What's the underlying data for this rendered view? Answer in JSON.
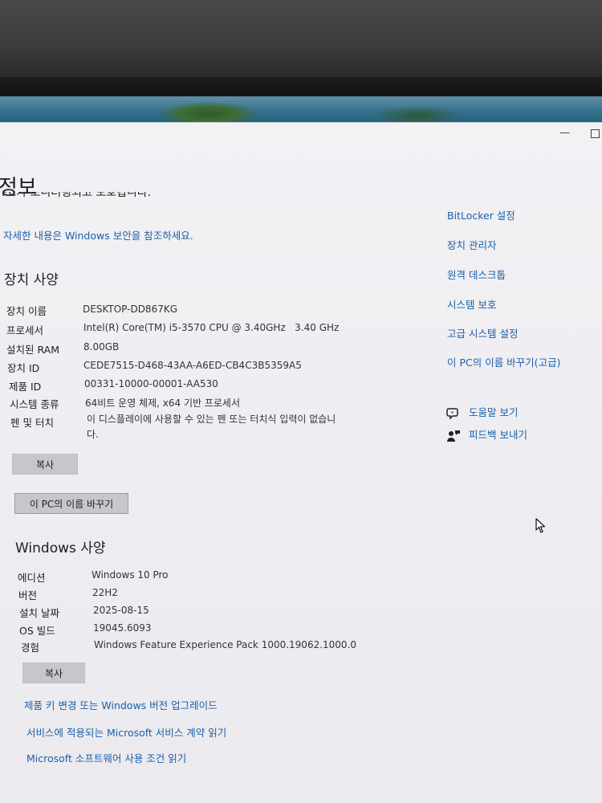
{
  "page": {
    "title": "정보",
    "cut_text": "PC가 모니터링되고 보호됩니다.",
    "security_link": "자세한 내용은 Windows 보안을 참조하세요."
  },
  "device_specs": {
    "title": "장치 사양",
    "rows": [
      {
        "label": "장치 이름",
        "value": "DESKTOP-DD867KG"
      },
      {
        "label": "프로세서",
        "value": "Intel(R) Core(TM) i5-3570 CPU @ 3.40GHz   3.40 GHz"
      },
      {
        "label": "설치된 RAM",
        "value": "8.00GB"
      },
      {
        "label": "장치 ID",
        "value": "CEDE7515-D468-43AA-A6ED-CB4C3B5359A5"
      },
      {
        "label": "제품 ID",
        "value": "00331-10000-00001-AA530"
      },
      {
        "label": "시스템 종류",
        "value": "64비트 운영 체제, x64 기반 프로세서"
      },
      {
        "label": "펜 및 터치",
        "value": "이 디스플레이에 사용할 수 있는 펜 또는 터치식 입력이 없습니다."
      }
    ],
    "copy_button": "복사",
    "rename_button": "이 PC의 이름 바꾸기"
  },
  "windows_specs": {
    "title": "Windows 사양",
    "rows": [
      {
        "label": "에디션",
        "value": "Windows 10 Pro"
      },
      {
        "label": "버전",
        "value": "22H2"
      },
      {
        "label": "설치 날짜",
        "value": "2025-08-15"
      },
      {
        "label": "OS 빌드",
        "value": "19045.6093"
      },
      {
        "label": "경험",
        "value": "Windows Feature Experience Pack 1000.19062.1000.0"
      }
    ],
    "copy_button": "복사"
  },
  "bottom_links": [
    "제품 키 변경 또는 Windows 버전 업그레이드",
    "서비스에 적용되는 Microsoft 서비스 계약 읽기",
    "Microsoft 소프트웨어 사용 조건 읽기"
  ],
  "side_links": [
    "BitLocker 설정",
    "장치 관리자",
    "원격 데스크톱",
    "시스템 보호",
    "고급 시스템 설정",
    "이 PC의 이름 바꾸기(고급)"
  ],
  "help_links": [
    {
      "label": "도움말 보기",
      "icon": "help-chat-icon"
    },
    {
      "label": "피드백 보내기",
      "icon": "feedback-icon"
    }
  ],
  "colors": {
    "link": "#1b5fa8",
    "window_bg": "#eeedf1",
    "button_bg": "#c7c7cb"
  }
}
